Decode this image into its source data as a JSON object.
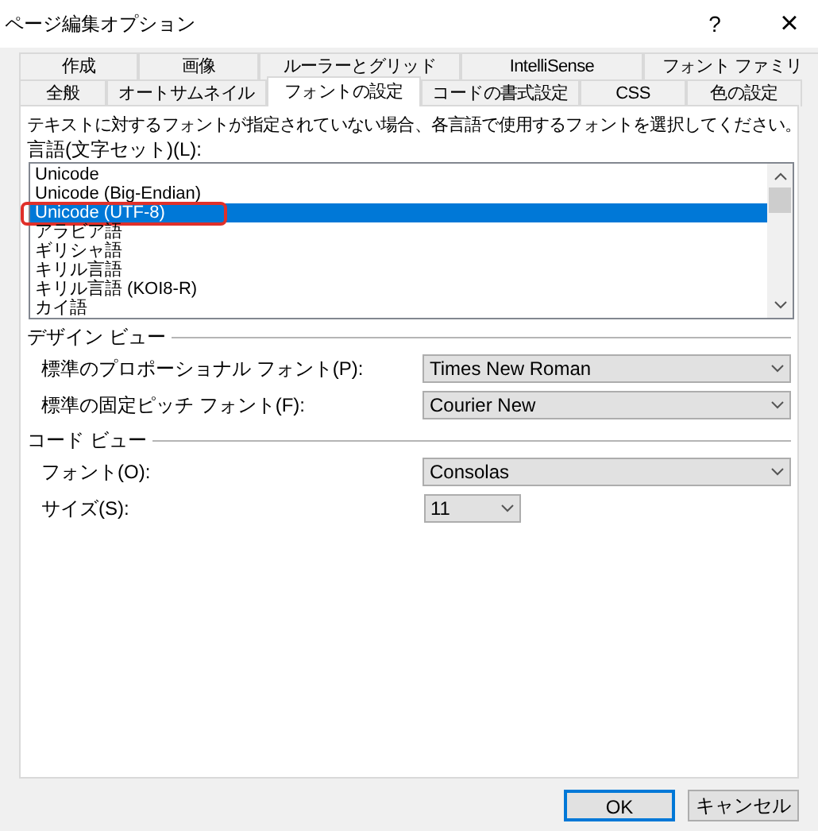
{
  "window": {
    "title": "ページ編集オプション",
    "help": "?",
    "close": "×"
  },
  "tab_rows": [
    [
      {
        "label": "作成",
        "selected": false
      },
      {
        "label": "画像",
        "selected": false
      },
      {
        "label": "ルーラーとグリッド",
        "selected": false
      },
      {
        "label": "IntelliSense",
        "selected": false
      },
      {
        "label": "フォント ファミリ",
        "selected": false
      }
    ],
    [
      {
        "label": "全般",
        "selected": false
      },
      {
        "label": "オートサムネイル",
        "selected": false
      },
      {
        "label": "フォントの設定",
        "selected": true
      },
      {
        "label": "コードの書式設定",
        "selected": false
      },
      {
        "label": "CSS",
        "selected": false
      },
      {
        "label": "色の設定",
        "selected": false
      }
    ]
  ],
  "description": "テキストに対するフォントが指定されていない場合、各言語で使用するフォントを選択してください。",
  "language_list": {
    "label": "言語(文字セット)(L):",
    "items": [
      {
        "label": "Unicode",
        "selected": false,
        "annotated": false
      },
      {
        "label": "Unicode (Big-Endian)",
        "selected": false,
        "annotated": false
      },
      {
        "label": "Unicode (UTF-8)",
        "selected": true,
        "annotated": true
      },
      {
        "label": "アラビア語",
        "selected": false,
        "annotated": false
      },
      {
        "label": "ギリシャ語",
        "selected": false,
        "annotated": false
      },
      {
        "label": "キリル言語",
        "selected": false,
        "annotated": false
      },
      {
        "label": "キリル言語 (KOI8-R)",
        "selected": false,
        "annotated": false
      },
      {
        "label": "カイ語",
        "selected": false,
        "annotated": false
      }
    ]
  },
  "sections": [
    {
      "title": "デザイン ビュー",
      "fields": [
        {
          "label": "標準のプロポーショナル フォント(P):",
          "value": "Times New Roman",
          "kind": "wide"
        },
        {
          "label": "標準の固定ピッチ フォント(F):",
          "value": "Courier New",
          "kind": "wide"
        }
      ]
    },
    {
      "title": "コード ビュー",
      "fields": [
        {
          "label": "フォント(O):",
          "value": "Consolas",
          "kind": "wide"
        },
        {
          "label": "サイズ(S):",
          "value": "11",
          "kind": "narrow"
        }
      ]
    }
  ],
  "buttons": [
    {
      "label": "OK",
      "default": true
    },
    {
      "label": "キャンセル",
      "default": false
    }
  ]
}
